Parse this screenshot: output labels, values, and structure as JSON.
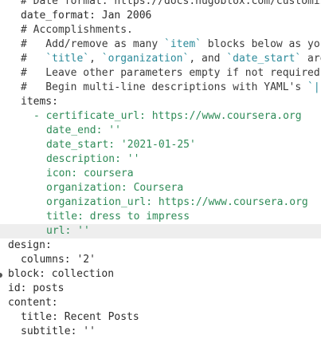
{
  "editor": {
    "lines": {
      "l0": {
        "text": "# Date format: https://docs.hugoblox.com/customiz"
      },
      "l1": {
        "key": "date_format:",
        "val": " Jan 2006"
      },
      "l2": {
        "text": "# Accomplishments."
      },
      "l3": {
        "a": "#   Add/remove as many ",
        "b": "`item`",
        "c": " blocks below as you"
      },
      "l4": {
        "a": "#   ",
        "b": "`title`",
        "c": ", ",
        "d": "`organization`",
        "e": ", and ",
        "f": "`date_start`",
        "g": " are"
      },
      "l5": {
        "text": "#   Leave other parameters empty if not required."
      },
      "l6": {
        "a": "#   Begin multi-line descriptions with YAML's ",
        "b": "`|"
      },
      "l7": {
        "key": "items:"
      },
      "l8": {
        "dash": "- ",
        "key": "certificate_url:",
        "val": " https://www.coursera.org"
      },
      "l9": {
        "key": "date_end:",
        "val": " ''"
      },
      "l10": {
        "key": "date_start:",
        "val": " '2021-01-25'"
      },
      "l11": {
        "key": "description:",
        "val": " ''"
      },
      "l12": {
        "key": "icon:",
        "val": " coursera"
      },
      "l13": {
        "key": "organization:",
        "val": " Coursera"
      },
      "l14": {
        "key": "organization_url:",
        "val": " https://www.coursera.org"
      },
      "l15": {
        "key": "title:",
        "val": " dress to impress"
      },
      "l16": {
        "key": "url:",
        "val": " ''"
      },
      "l17": {
        "key": "design:"
      },
      "l18": {
        "key": "columns:",
        "val": " '2'"
      },
      "l19": {
        "key": "block:",
        "val": " collection"
      },
      "l20": {
        "key": "id:",
        "val": " posts"
      },
      "l21": {
        "key": "content:"
      },
      "l22": {
        "key": "title:",
        "val": " Recent Posts"
      },
      "l23": {
        "key": "subtitle:",
        "val": " ''"
      }
    }
  }
}
